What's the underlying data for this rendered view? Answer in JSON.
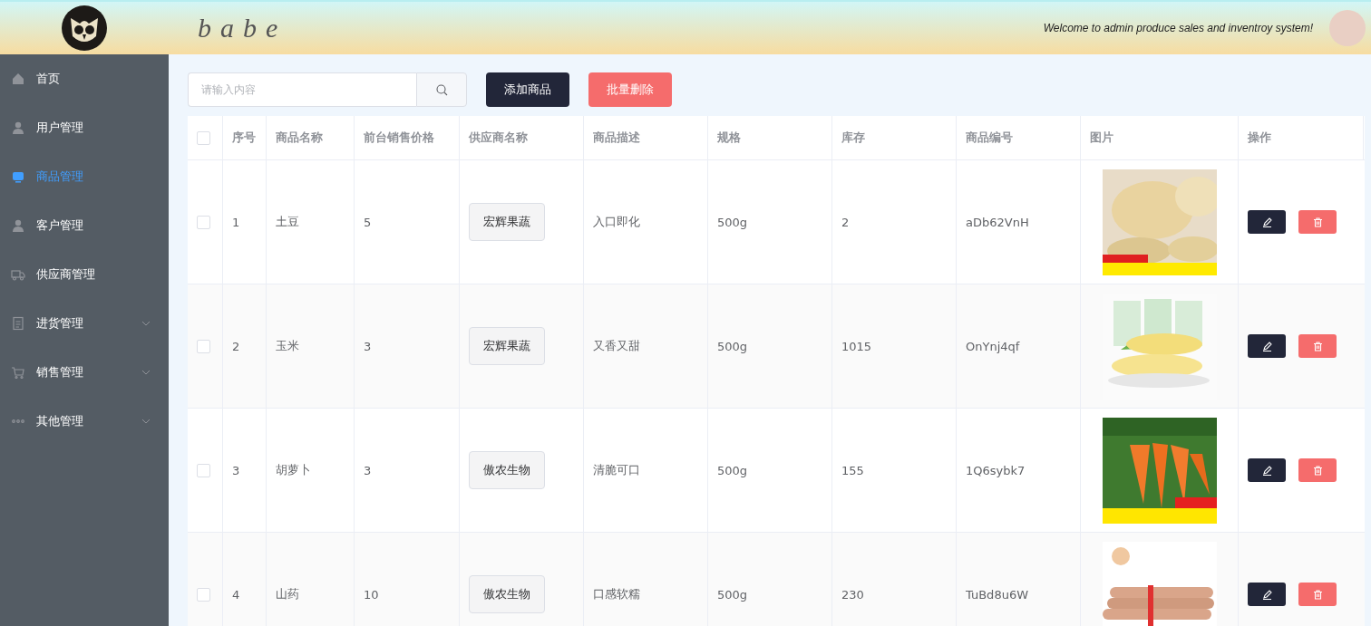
{
  "header": {
    "brand": "babe",
    "welcome": "Welcome to admin produce sales and inventroy system!"
  },
  "sidebar": {
    "items": [
      {
        "label": "首页",
        "selected": false,
        "has_submenu": false
      },
      {
        "label": "用户管理",
        "selected": false,
        "has_submenu": false
      },
      {
        "label": "商品管理",
        "selected": true,
        "has_submenu": false
      },
      {
        "label": "客户管理",
        "selected": false,
        "has_submenu": false
      },
      {
        "label": "供应商管理",
        "selected": false,
        "has_submenu": false
      },
      {
        "label": "进货管理",
        "selected": false,
        "has_submenu": true
      },
      {
        "label": "销售管理",
        "selected": false,
        "has_submenu": true
      },
      {
        "label": "其他管理",
        "selected": false,
        "has_submenu": true
      }
    ]
  },
  "toolbar": {
    "search": {
      "placeholder": "请输入内容"
    },
    "add_button": "添加商品",
    "batch_delete_button": "批量删除"
  },
  "table": {
    "select_all": {
      "checked": false
    },
    "columns": [
      "序号",
      "商品名称",
      "前台销售价格",
      "供应商名称",
      "商品描述",
      "规格",
      "库存",
      "商品编号",
      "图片",
      "操作"
    ],
    "rows": [
      {
        "checked": false,
        "no": "1",
        "name": "土豆",
        "price": "5",
        "supplier": "宏辉果蔬",
        "description": "入口即化",
        "spec": "500g",
        "stock": "2",
        "code": "aDb62VnH"
      },
      {
        "checked": false,
        "no": "2",
        "name": "玉米",
        "price": "3",
        "supplier": "宏辉果蔬",
        "description": "又香又甜",
        "spec": "500g",
        "stock": "1015",
        "code": "OnYnj4qf"
      },
      {
        "checked": false,
        "no": "3",
        "name": "胡萝卜",
        "price": "3",
        "supplier": "傲农生物",
        "description": "清脆可口",
        "spec": "500g",
        "stock": "155",
        "code": "1Q6sybk7"
      },
      {
        "checked": false,
        "no": "4",
        "name": "山药",
        "price": "10",
        "supplier": "傲农生物",
        "description": "口感软糯",
        "spec": "500g",
        "stock": "230",
        "code": "TuBd8u6W"
      }
    ]
  }
}
